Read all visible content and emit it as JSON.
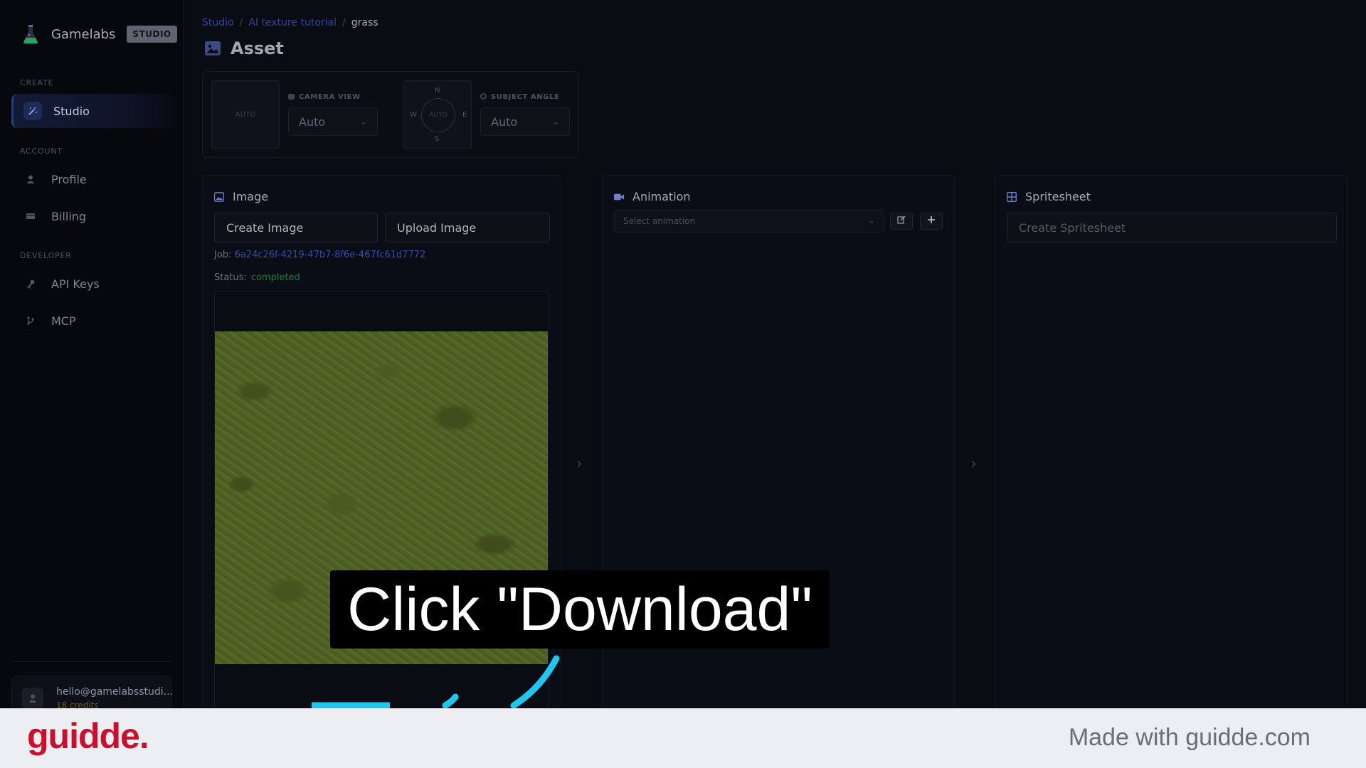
{
  "brand": {
    "name": "Gamelabs",
    "badge": "STUDIO"
  },
  "sidebar": {
    "sections": {
      "create": "CREATE",
      "account": "ACCOUNT",
      "developer": "DEVELOPER"
    },
    "items": [
      {
        "label": "Studio",
        "icon": "magic-wand-icon"
      },
      {
        "label": "Profile",
        "icon": "user-icon"
      },
      {
        "label": "Billing",
        "icon": "card-icon"
      },
      {
        "label": "API Keys",
        "icon": "key-icon"
      },
      {
        "label": "MCP",
        "icon": "git-branch-icon"
      }
    ],
    "user": {
      "email": "hello@gamelabsstudi...",
      "credits": "18 credits"
    }
  },
  "breadcrumb": {
    "items": [
      "Studio",
      "AI texture tutorial"
    ],
    "current": "grass",
    "separator": "/"
  },
  "page": {
    "title": "Asset"
  },
  "controls": {
    "auto_box": "AUTO",
    "camera_view": {
      "label": "CAMERA VIEW",
      "value": "Auto"
    },
    "compass": {
      "n": "N",
      "s": "S",
      "e": "E",
      "w": "W",
      "center": "AUTO"
    },
    "subject_angle": {
      "label": "SUBJECT ANGLE",
      "value": "Auto"
    }
  },
  "image_panel": {
    "title": "Image",
    "create_button": "Create Image",
    "upload_button": "Upload Image",
    "job_label": "Job:",
    "job_id": "6a24c26f-4219-47b7-8f6e-467fc61d7772",
    "status_label": "Status:",
    "status_value": "completed"
  },
  "animation_panel": {
    "title": "Animation",
    "select_placeholder": "Select animation",
    "edit_icon": "edit-icon",
    "add_icon": "plus-icon"
  },
  "spritesheet_panel": {
    "title": "Spritesheet",
    "create_button": "Create Spritesheet"
  },
  "overlay": {
    "text": "Click \"Download\""
  },
  "footer": {
    "logo": "guidde.",
    "made_with": "Made with guidde.com"
  },
  "colors": {
    "accent": "#3343a0",
    "status_ok": "#1f7a3d",
    "highlight": "#20c5f0",
    "logo_red": "#c8102e"
  }
}
